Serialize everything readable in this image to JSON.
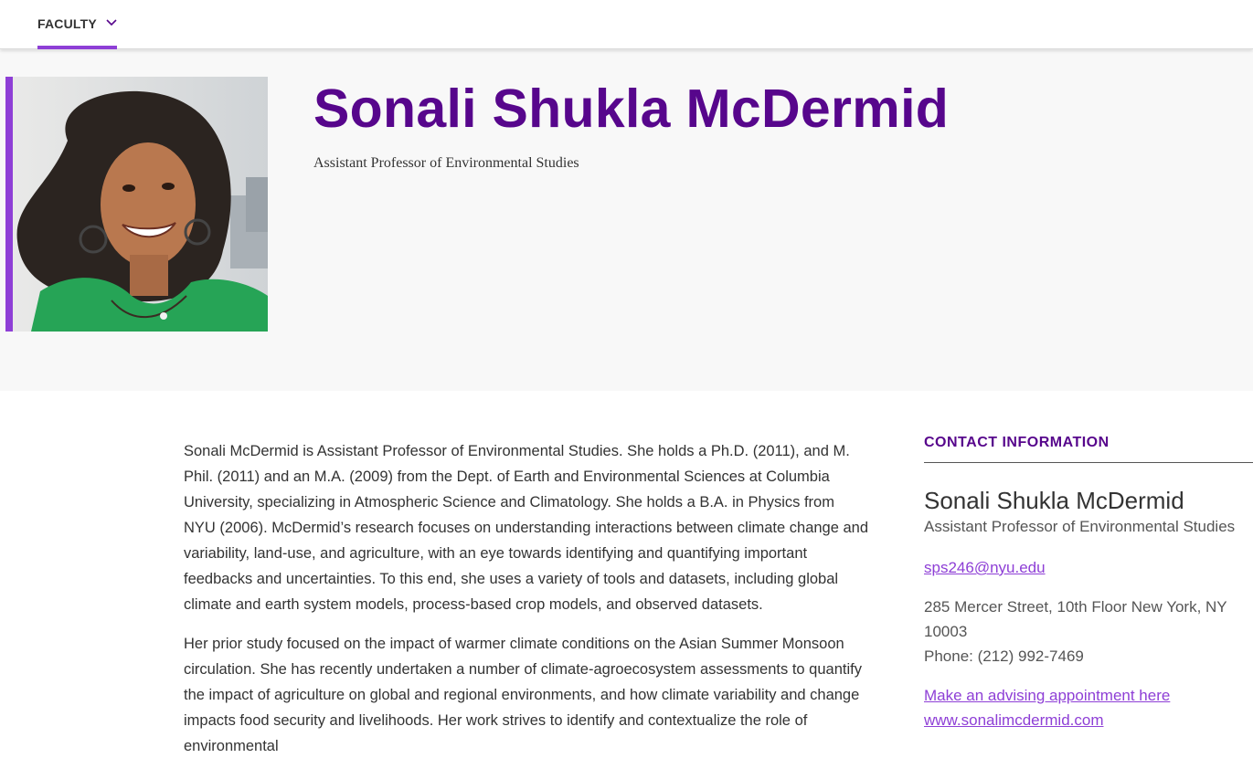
{
  "nav": {
    "label": "FACULTY"
  },
  "profile": {
    "name": "Sonali Shukla McDermid",
    "title": "Assistant Professor of Environmental Studies"
  },
  "bio": {
    "paragraphs": [
      "Sonali McDermid is Assistant Professor of Environmental Studies. She holds a Ph.D. (2011), and M. Phil. (2011) and an M.A. (2009) from the Dept. of Earth and Environmental Sciences at Columbia University, specializing in Atmospheric Science and Climatology. She holds a B.A. in Physics from NYU (2006). McDermid’s research focuses on understanding interactions between climate change and variability, land-use, and agriculture, with an eye towards identifying and quantifying important feedbacks and uncertainties. To this end, she uses a variety of tools and datasets, including global climate and earth system models, process-based crop models, and observed datasets.",
      "Her prior study focused on the impact of warmer climate conditions on the Asian Summer Monsoon circulation. She has recently undertaken a number of climate-agroecosystem assessments to quantify the impact of agriculture on global and regional environments, and how climate variability and change impacts food security and livelihoods. Her work strives to identify and contextualize the role of environmental"
    ]
  },
  "contact": {
    "heading": "CONTACT INFORMATION",
    "name": "Sonali Shukla McDermid",
    "role": "Assistant Professor of Environmental Studies",
    "email": "sps246@nyu.edu",
    "address": "285 Mercer Street, 10th Floor New York, NY 10003",
    "phone": "Phone: (212) 992-7469",
    "advising_link": "Make an advising appointment here",
    "website": "www.sonalimcdermid.com"
  },
  "colors": {
    "accent": "#8e3fd6",
    "brand_purple": "#57068c"
  },
  "icons": {
    "nav_dropdown": "chevron-down-icon"
  }
}
